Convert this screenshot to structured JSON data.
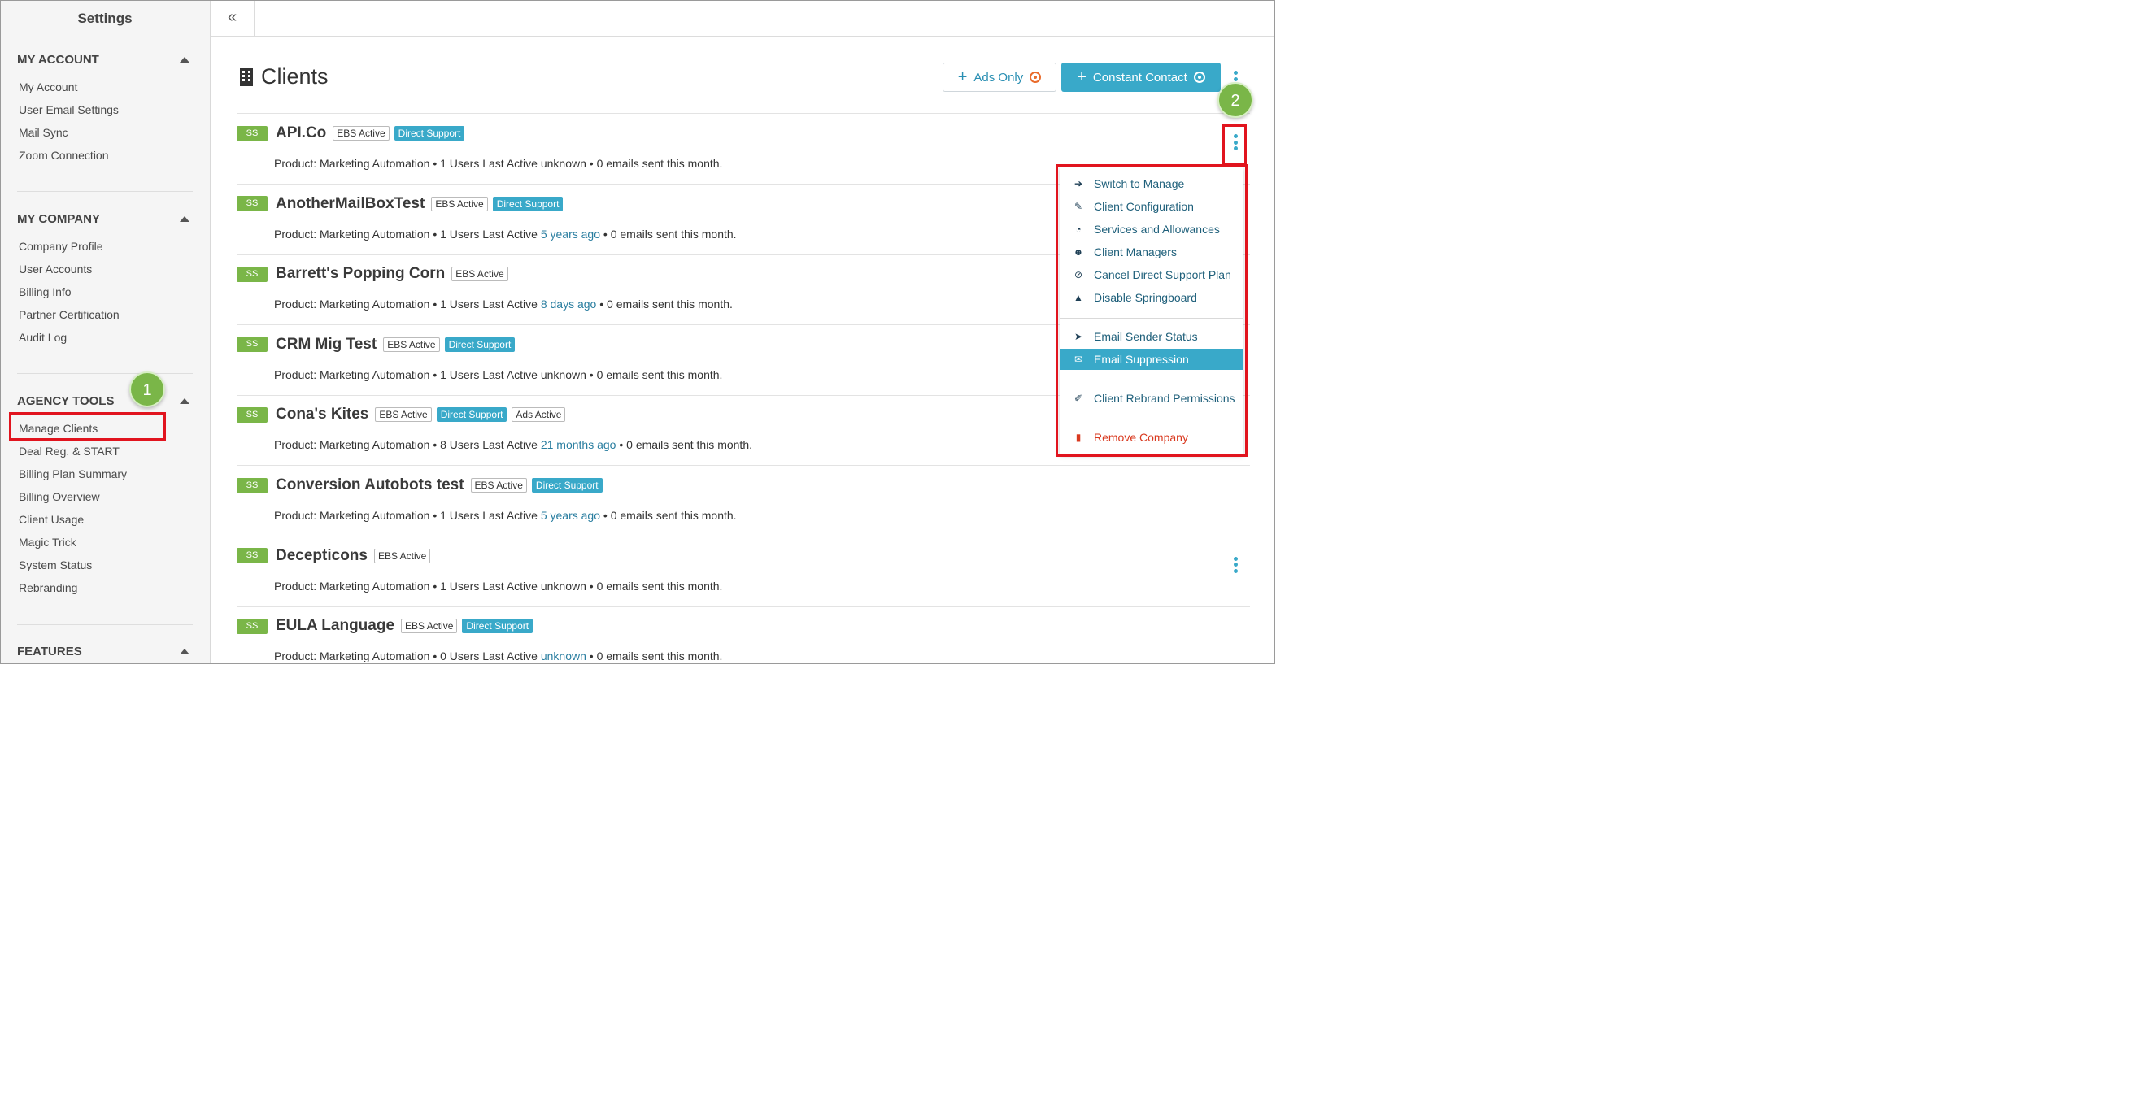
{
  "sidebar": {
    "title": "Settings",
    "sections": [
      {
        "header": "MY ACCOUNT",
        "items": [
          "My Account",
          "User Email Settings",
          "Mail Sync",
          "Zoom Connection"
        ]
      },
      {
        "header": "MY COMPANY",
        "items": [
          "Company Profile",
          "User Accounts",
          "Billing Info",
          "Partner Certification",
          "Audit Log"
        ]
      },
      {
        "header": "AGENCY TOOLS",
        "items": [
          "Manage Clients",
          "Deal Reg. & START",
          "Billing Plan Summary",
          "Billing Overview",
          "Client Usage",
          "Magic Trick",
          "System Status",
          "Rebranding"
        ]
      },
      {
        "header": "FEATURES",
        "items": []
      }
    ]
  },
  "callouts": {
    "one": "1",
    "two": "2"
  },
  "topbar": {
    "collapse_glyph": "«"
  },
  "page": {
    "title": "Clients",
    "ads_only_label": "Ads Only",
    "constant_contact_label": "Constant Contact"
  },
  "clients": [
    {
      "badge": "SS",
      "name": "API.Co",
      "tags": [
        {
          "text": "EBS Active",
          "style": "outline"
        },
        {
          "text": "Direct Support",
          "style": "blue"
        }
      ],
      "product": "Product: Marketing Automation • 1 Users Last Active ",
      "last_active": "unknown",
      "last_active_link": false,
      "emails": " • 0 emails sent this month."
    },
    {
      "badge": "SS",
      "name": "AnotherMailBoxTest",
      "tags": [
        {
          "text": "EBS Active",
          "style": "outline"
        },
        {
          "text": "Direct Support",
          "style": "blue"
        }
      ],
      "product": "Product: Marketing Automation • 1 Users Last Active ",
      "last_active": "5 years ago",
      "last_active_link": true,
      "emails": " • 0 emails sent this month."
    },
    {
      "badge": "SS",
      "name": "Barrett's Popping Corn",
      "tags": [
        {
          "text": "EBS Active",
          "style": "outline"
        }
      ],
      "product": "Product: Marketing Automation • 1 Users Last Active ",
      "last_active": "8 days ago",
      "last_active_link": true,
      "emails": " • 0 emails sent this month."
    },
    {
      "badge": "SS",
      "name": "CRM Mig Test",
      "tags": [
        {
          "text": "EBS Active",
          "style": "outline"
        },
        {
          "text": "Direct Support",
          "style": "blue"
        }
      ],
      "product": "Product: Marketing Automation • 1 Users Last Active ",
      "last_active": "unknown",
      "last_active_link": false,
      "emails": " • 0 emails sent this month."
    },
    {
      "badge": "SS",
      "name": "Cona's Kites",
      "tags": [
        {
          "text": "EBS Active",
          "style": "outline"
        },
        {
          "text": "Direct Support",
          "style": "blue"
        },
        {
          "text": "Ads Active",
          "style": "outline"
        }
      ],
      "product": "Product: Marketing Automation • 8 Users Last Active ",
      "last_active": "21 months ago",
      "last_active_link": true,
      "emails": " • 0 emails sent this month."
    },
    {
      "badge": "SS",
      "name": "Conversion Autobots test",
      "tags": [
        {
          "text": "EBS Active",
          "style": "outline"
        },
        {
          "text": "Direct Support",
          "style": "blue"
        }
      ],
      "product": "Product: Marketing Automation • 1 Users Last Active ",
      "last_active": "5 years ago",
      "last_active_link": true,
      "emails": " • 0 emails sent this month."
    },
    {
      "badge": "SS",
      "name": "Decepticons",
      "tags": [
        {
          "text": "EBS Active",
          "style": "outline"
        }
      ],
      "product": "Product: Marketing Automation • 1 Users Last Active ",
      "last_active": "unknown",
      "last_active_link": false,
      "emails": " • 0 emails sent this month."
    },
    {
      "badge": "SS",
      "name": "EULA Language",
      "tags": [
        {
          "text": "EBS Active",
          "style": "outline"
        },
        {
          "text": "Direct Support",
          "style": "blue"
        }
      ],
      "product": "Product: Marketing Automation • 0 Users Last Active ",
      "last_active": "unknown",
      "last_active_link": true,
      "emails": " • 0 emails sent this month."
    }
  ],
  "menu": {
    "groups": [
      [
        {
          "label": "Switch to Manage",
          "icon": "sign-in-icon"
        },
        {
          "label": "Client Configuration",
          "icon": "wrench-icon"
        },
        {
          "label": "Services and Allowances",
          "icon": "dashboard-icon"
        },
        {
          "label": "Client Managers",
          "icon": "users-icon"
        },
        {
          "label": "Cancel Direct Support Plan",
          "icon": "ban-icon"
        },
        {
          "label": "Disable Springboard",
          "icon": "graduation-cap-icon"
        }
      ],
      [
        {
          "label": "Email Sender Status",
          "icon": "paper-plane-icon"
        },
        {
          "label": "Email Suppression",
          "icon": "envelope-icon",
          "active": true
        }
      ],
      [
        {
          "label": "Client Rebrand Permissions",
          "icon": "paintbrush-icon"
        }
      ],
      [
        {
          "label": "Remove Company",
          "icon": "trash-icon",
          "danger": true
        }
      ]
    ]
  },
  "colors": {
    "accent": "#39a9c9",
    "badge_green": "#7ab648",
    "highlight_red": "#e1141e",
    "danger": "#d9391f"
  }
}
